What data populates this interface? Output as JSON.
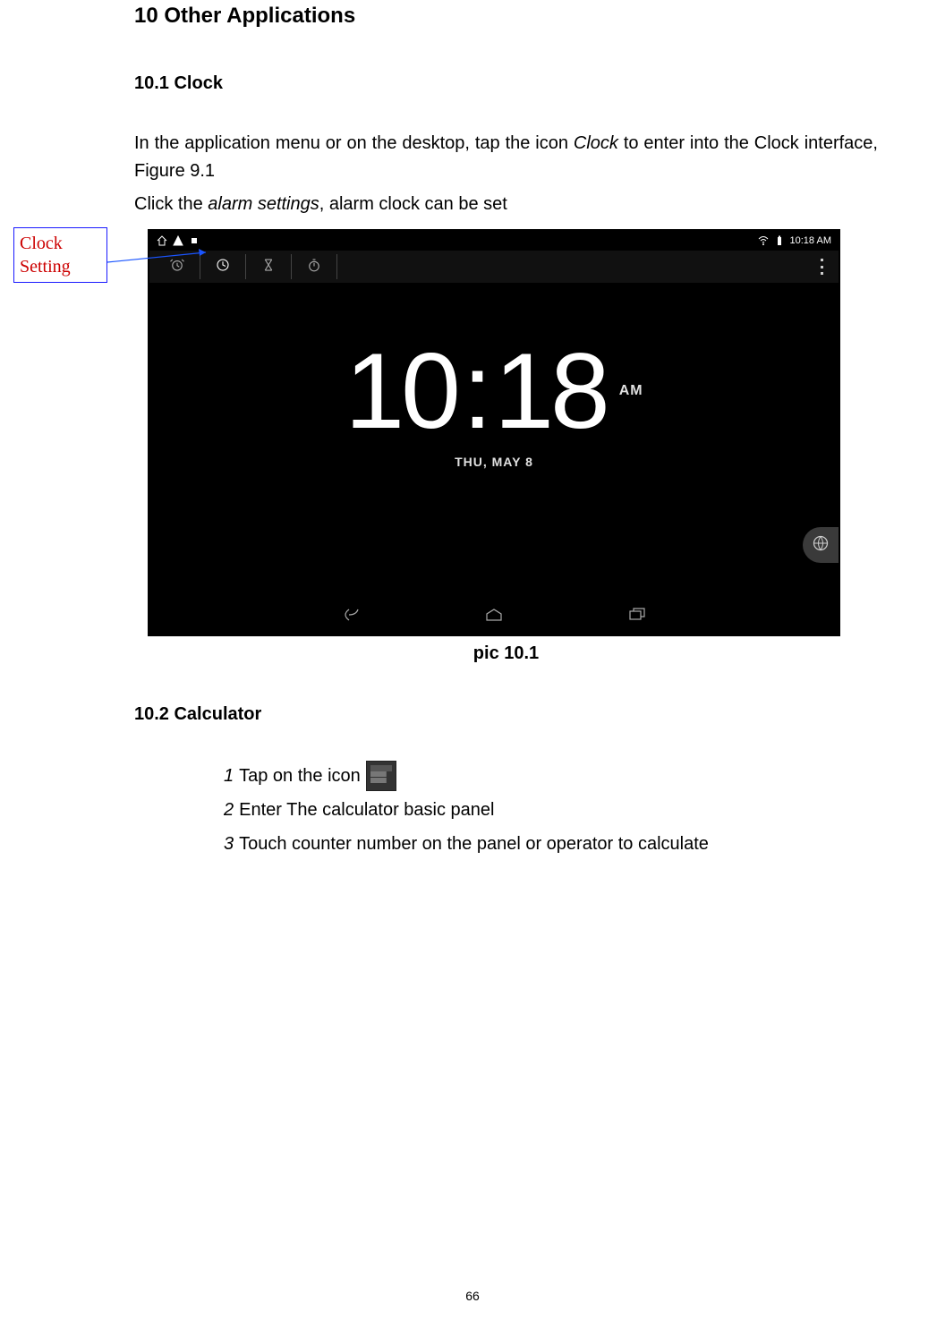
{
  "headings": {
    "h1": "10 Other Applications",
    "h2_clock": "10.1 Clock",
    "h2_calc": "10.2 Calculator"
  },
  "paragraphs": {
    "p1_a": "In the application menu or on the desktop, tap the icon ",
    "p1_italic": "Clock",
    "p1_b": " to enter into the Clock interface, Figure 9.1",
    "p2_a": "Click the ",
    "p2_italic": "alarm settings",
    "p2_b": ", alarm clock can be set"
  },
  "callout": {
    "line1": "Clock",
    "line2": "Setting"
  },
  "screenshot": {
    "statusbar": {
      "time": "10:18 AM"
    },
    "clock": {
      "hour": "10",
      "minute": "18",
      "ampm": "AM",
      "date": "THU, MAY 8"
    }
  },
  "figure_caption": "pic 10.1",
  "calc_list": {
    "n1": "1",
    "t1": " Tap on the icon ",
    "n2": "2",
    "t2": " Enter The calculator basic panel",
    "n3": "3",
    "t3": " Touch counter number on the panel or operator to calculate"
  },
  "page_number": "66"
}
